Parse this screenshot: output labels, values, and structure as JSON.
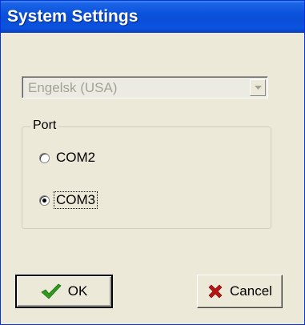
{
  "window": {
    "title": "System Settings"
  },
  "language_select": {
    "value": "Engelsk (USA)",
    "enabled": false
  },
  "port_group": {
    "label": "Port",
    "options": [
      {
        "label": "COM2",
        "selected": false
      },
      {
        "label": "COM3",
        "selected": true
      }
    ]
  },
  "buttons": {
    "ok_label": "OK",
    "cancel_label": "Cancel"
  },
  "icons": {
    "ok": "checkmark-icon",
    "cancel": "x-icon",
    "dropdown": "chevron-down-icon"
  },
  "colors": {
    "titlebar": "#0a53dc",
    "checkmark": "#2e9a1e",
    "cancel_x": "#b81414"
  }
}
